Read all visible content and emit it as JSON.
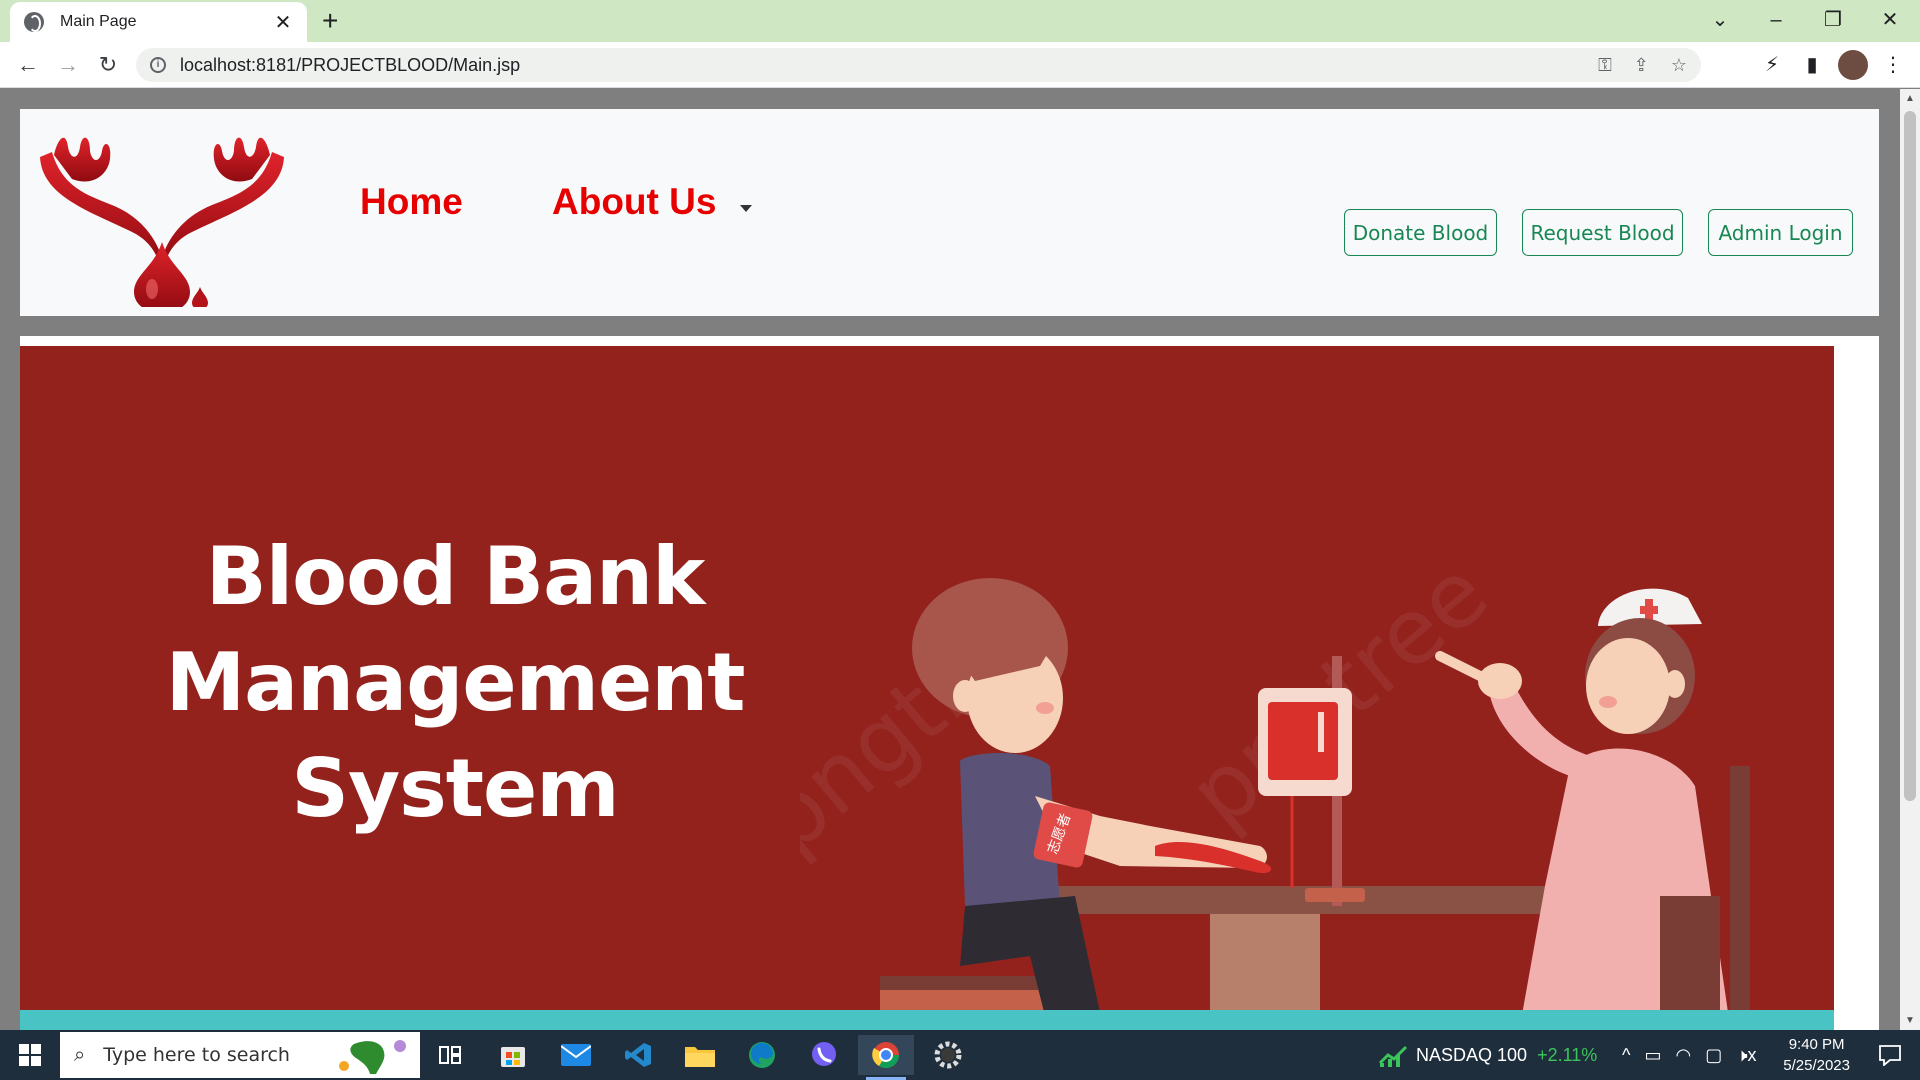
{
  "browser": {
    "tab_title": "Main Page",
    "tab_close": "✕",
    "new_tab": "+",
    "url": "localhost:8181/PROJECTBLOOD/Main.jsp",
    "window_controls": {
      "dropdown": "⌄",
      "minimize": "–",
      "restore": "❐",
      "close": "✕"
    },
    "nav": {
      "back": "←",
      "forward": "→",
      "reload": "↻"
    },
    "omnibox_icons": {
      "key": "⚿",
      "share": "⇪",
      "star": "☆"
    },
    "toolbar_icons": {
      "extension": "⚡",
      "sidepanel": "▮",
      "menu": "⋮"
    }
  },
  "navbar": {
    "links": [
      {
        "label": "Home"
      },
      {
        "label": "About Us"
      }
    ],
    "buttons": [
      {
        "label": "Donate Blood"
      },
      {
        "label": "Request Blood"
      },
      {
        "label": "Admin Login"
      }
    ]
  },
  "hero": {
    "title_lines": [
      "Blood Bank",
      "Management",
      "System"
    ],
    "armband_text": "志愿者",
    "watermark": "pngtree"
  },
  "taskbar": {
    "search_placeholder": "Type here to search",
    "stock_name": "NASDAQ 100",
    "stock_change": "+2.11%",
    "time": "9:40 PM",
    "date": "5/25/2023",
    "tray_icons": {
      "chevron": "^",
      "battery": "▭",
      "wifi": "◠",
      "meet": "▢",
      "volume": "🕨x"
    }
  },
  "colors": {
    "accent_red": "#e60000",
    "hero_bg": "#93221d",
    "button_green": "#198754",
    "teal": "#49c3c4",
    "tabstrip": "#cfe8c3"
  }
}
